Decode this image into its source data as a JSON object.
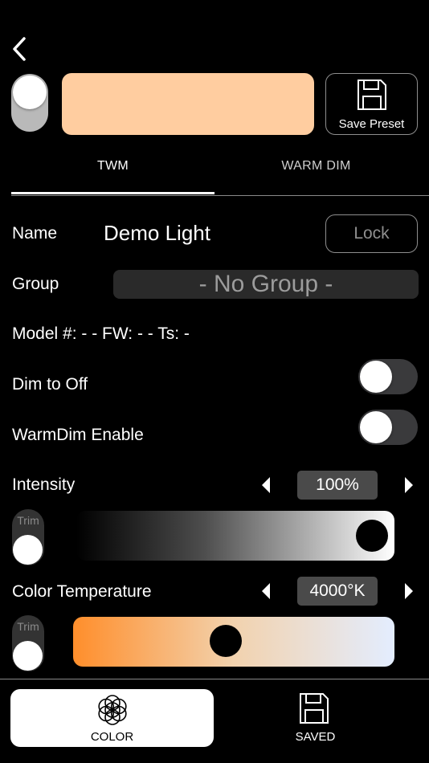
{
  "header": {
    "back_icon": "chevron-left-icon",
    "swatch_color": "#FFCDA0",
    "save_preset_label": "Save Preset",
    "save_preset_icon": "floppy-disk-icon",
    "power_on": true
  },
  "tabs": [
    {
      "label": "TWM",
      "active": true
    },
    {
      "label": "WARM DIM",
      "active": false
    }
  ],
  "name": {
    "label": "Name",
    "value": "Demo Light",
    "lock_label": "Lock"
  },
  "group": {
    "label": "Group",
    "selected": "- No Group -"
  },
  "model_line": "Model #: - - FW: - - Ts: -",
  "dim_to_off": {
    "label": "Dim to Off",
    "enabled": false
  },
  "warmdim_enable": {
    "label": "WarmDim Enable",
    "enabled": false
  },
  "intensity": {
    "label": "Intensity",
    "value_text": "100%",
    "level": 1.0,
    "trim_label": "Trim"
  },
  "color_temperature": {
    "label": "Color Temperature",
    "value_text": "4000°K",
    "level": 0.47,
    "trim_label": "Trim",
    "gradient": [
      "#FF8E2B",
      "#F2D2AE",
      "#E3EDFF"
    ]
  },
  "bottom_tabs": [
    {
      "label": "COLOR",
      "icon": "flower-of-life-icon",
      "active": true
    },
    {
      "label": "SAVED",
      "icon": "floppy-disk-icon",
      "active": false
    }
  ]
}
